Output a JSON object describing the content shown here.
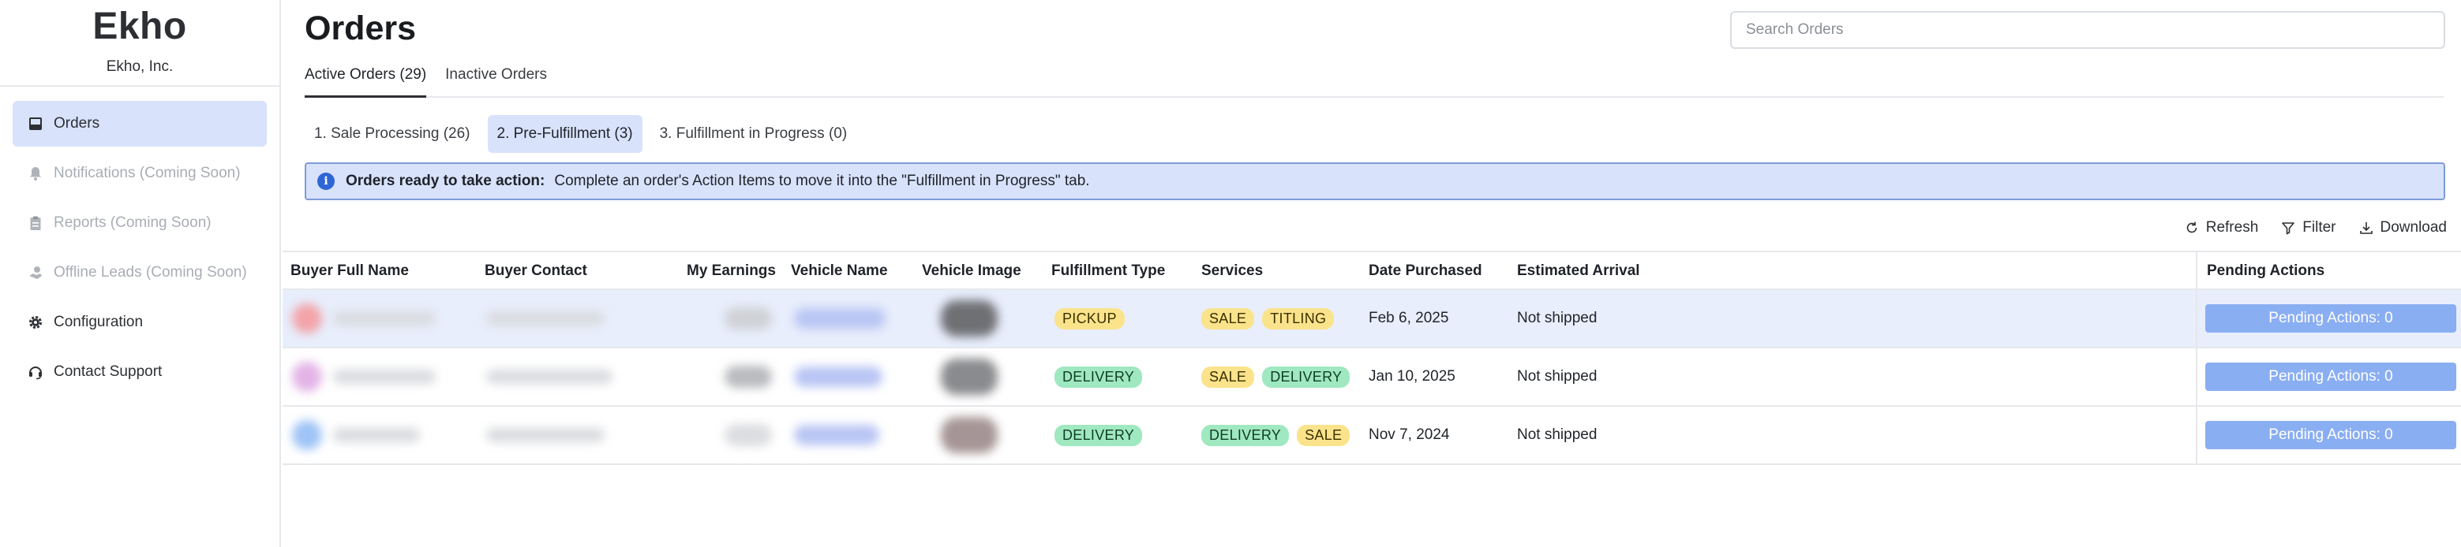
{
  "sidebar": {
    "brand_name": "Ekho",
    "brand_sub": "Ekho, Inc.",
    "items": [
      {
        "label": "Orders",
        "icon": "inbox-icon",
        "active": true
      },
      {
        "label": "Notifications (Coming Soon)",
        "icon": "bell-icon",
        "disabled": true
      },
      {
        "label": "Reports (Coming Soon)",
        "icon": "clipboard-icon",
        "disabled": true
      },
      {
        "label": "Offline Leads (Coming Soon)",
        "icon": "leads-icon",
        "disabled": true
      },
      {
        "label": "Configuration",
        "icon": "gear-icon"
      },
      {
        "label": "Contact Support",
        "icon": "headset-icon"
      }
    ]
  },
  "header": {
    "title": "Orders",
    "search_placeholder": "Search Orders"
  },
  "tabs": [
    {
      "label": "Active Orders (29)",
      "active": true
    },
    {
      "label": "Inactive Orders",
      "active": false
    }
  ],
  "sub_tabs": [
    {
      "label": "1. Sale Processing (26)",
      "active": false
    },
    {
      "label": "2. Pre-Fulfillment (3)",
      "active": true
    },
    {
      "label": "3. Fulfillment in Progress (0)",
      "active": false
    }
  ],
  "banner": {
    "bold": "Orders ready to take action:",
    "text": "Complete an order's Action Items to move it into the \"Fulfillment in Progress\" tab."
  },
  "toolbar": {
    "refresh": "Refresh",
    "filter": "Filter",
    "download": "Download"
  },
  "table": {
    "columns": [
      "Buyer Full Name",
      "Buyer Contact",
      "My Earnings",
      "Vehicle Name",
      "Vehicle Image",
      "Fulfillment Type",
      "Services",
      "Date Purchased",
      "Estimated Arrival",
      "Pending Actions"
    ],
    "rows": [
      {
        "fulfillment": "PICKUP",
        "services": [
          "SALE",
          "TITLING"
        ],
        "date": "Feb 6, 2025",
        "arrival": "Not shipped",
        "pending": "Pending Actions: 0",
        "highlight": true
      },
      {
        "fulfillment": "DELIVERY",
        "services": [
          "SALE",
          "DELIVERY"
        ],
        "date": "Jan 10, 2025",
        "arrival": "Not shipped",
        "pending": "Pending Actions: 0",
        "highlight": false
      },
      {
        "fulfillment": "DELIVERY",
        "services": [
          "DELIVERY",
          "SALE"
        ],
        "date": "Nov 7, 2024",
        "arrival": "Not shipped",
        "pending": "Pending Actions: 0",
        "highlight": false
      }
    ]
  },
  "colors": {
    "accent": "#d8e2fb",
    "badge_yellow": "#fbe38b",
    "badge_green": "#9fe8c0",
    "pending_button": "#8aaef2"
  }
}
